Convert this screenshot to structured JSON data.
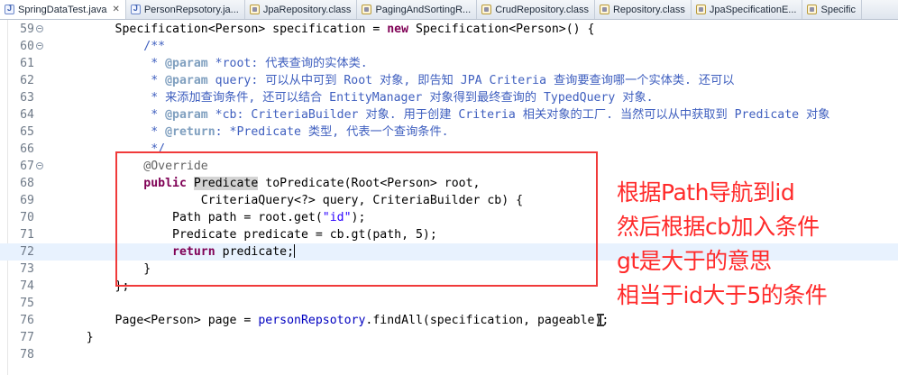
{
  "tabs": [
    {
      "label": "SpringDataTest.java",
      "icon": "java-file-icon",
      "active": true,
      "closable": true
    },
    {
      "label": "PersonRepsotory.ja...",
      "icon": "java-file-icon"
    },
    {
      "label": "JpaRepository.class",
      "icon": "class-file-icon"
    },
    {
      "label": "PagingAndSortingR...",
      "icon": "class-file-icon"
    },
    {
      "label": "CrudRepository.class",
      "icon": "class-file-icon"
    },
    {
      "label": "Repository.class",
      "icon": "class-file-icon"
    },
    {
      "label": "JpaSpecificationE...",
      "icon": "class-file-icon"
    },
    {
      "label": "Specific",
      "icon": "class-file-icon"
    }
  ],
  "editor": {
    "current_line": "72",
    "lines": [
      {
        "n": "59",
        "fold": "-",
        "segs": [
          {
            "t": "        Specification<Person> specification = "
          },
          {
            "t": "new",
            "c": "kw"
          },
          {
            "t": " Specification<Person>() {"
          }
        ]
      },
      {
        "n": "60",
        "fold": "-",
        "segs": [
          {
            "t": "            /**",
            "c": "cm"
          }
        ]
      },
      {
        "n": "61",
        "segs": [
          {
            "t": "             * ",
            "c": "cm"
          },
          {
            "t": "@param",
            "c": "tag"
          },
          {
            "t": " *root: 代表查询的实体类.",
            "c": "cm"
          }
        ]
      },
      {
        "n": "62",
        "segs": [
          {
            "t": "             * ",
            "c": "cm"
          },
          {
            "t": "@param",
            "c": "tag"
          },
          {
            "t": " query: 可以从中可到 Root 对象, 即告知 JPA Criteria 查询要查询哪一个实体类. 还可以",
            "c": "cm"
          }
        ]
      },
      {
        "n": "63",
        "segs": [
          {
            "t": "             * 来添加查询条件, 还可以结合 EntityManager 对象得到最终查询的 TypedQuery 对象.",
            "c": "cm"
          }
        ]
      },
      {
        "n": "64",
        "segs": [
          {
            "t": "             * ",
            "c": "cm"
          },
          {
            "t": "@param",
            "c": "tag"
          },
          {
            "t": " *cb: CriteriaBuilder 对象. 用于创建 Criteria 相关对象的工厂. 当然可以从中获取到 Predicate 对象",
            "c": "cm"
          }
        ]
      },
      {
        "n": "65",
        "segs": [
          {
            "t": "             * ",
            "c": "cm"
          },
          {
            "t": "@return",
            "c": "tag"
          },
          {
            "t": ": *Predicate 类型, 代表一个查询条件.",
            "c": "cm"
          }
        ]
      },
      {
        "n": "66",
        "segs": [
          {
            "t": "             */",
            "c": "cm"
          }
        ]
      },
      {
        "n": "67",
        "fold": "-",
        "segs": [
          {
            "t": "            "
          },
          {
            "t": "@Override",
            "c": "ann"
          }
        ]
      },
      {
        "n": "68",
        "segs": [
          {
            "t": "            "
          },
          {
            "t": "public",
            "c": "kw"
          },
          {
            "t": " "
          },
          {
            "t": "Predicate",
            "c": "hl"
          },
          {
            "t": " toPredicate(Root<Person> root,"
          }
        ]
      },
      {
        "n": "69",
        "segs": [
          {
            "t": "                    CriteriaQuery<?> query, CriteriaBuilder cb) {"
          }
        ]
      },
      {
        "n": "70",
        "segs": [
          {
            "t": "                Path path = root.get("
          },
          {
            "t": "\"id\"",
            "c": "str"
          },
          {
            "t": ");"
          }
        ]
      },
      {
        "n": "71",
        "segs": [
          {
            "t": "                Predicate predicate = cb.gt(path, 5);"
          }
        ]
      },
      {
        "n": "72",
        "segs": [
          {
            "t": "                "
          },
          {
            "t": "return",
            "c": "kw"
          },
          {
            "t": " predicate;"
          }
        ],
        "caret": true
      },
      {
        "n": "73",
        "segs": [
          {
            "t": "            }"
          }
        ]
      },
      {
        "n": "74",
        "segs": [
          {
            "t": "        };"
          }
        ]
      },
      {
        "n": "75",
        "segs": [
          {
            "t": ""
          }
        ]
      },
      {
        "n": "76",
        "segs": [
          {
            "t": "        Page<Person> page = "
          },
          {
            "t": "personRepsotory",
            "c": "fld"
          },
          {
            "t": ".findAll(specification, pageable);"
          }
        ]
      },
      {
        "n": "77",
        "segs": [
          {
            "t": "    }"
          }
        ]
      },
      {
        "n": "78",
        "segs": [
          {
            "t": ""
          }
        ]
      }
    ]
  },
  "annotation_note": [
    "根据Path导航到id",
    "然后根据cb加入条件",
    "gt是大于的意思",
    "相当于id大于5的条件"
  ],
  "colors": {
    "keyword": "#7f0055",
    "comment": "#3f5fbf",
    "string": "#2a00ff",
    "annotation_box": "#f03a3a",
    "annotation_text": "#ff2a2a",
    "current_line_bg": "#e8f2fe"
  }
}
